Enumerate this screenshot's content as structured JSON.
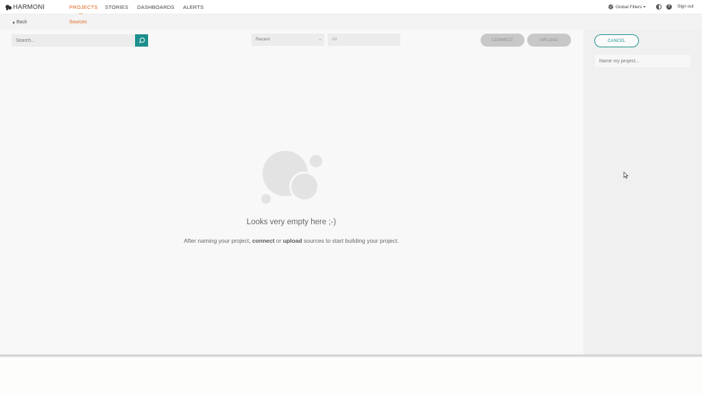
{
  "app": {
    "name": "HARMONI"
  },
  "nav": {
    "items": [
      {
        "label": "PROJECTS",
        "active": true
      },
      {
        "label": "STORIES",
        "active": false
      },
      {
        "label": "DASHBOARDS",
        "active": false
      },
      {
        "label": "ALERTS",
        "active": false
      }
    ],
    "global_filters_label": "Global Filters",
    "sign_out_label": "Sign out"
  },
  "breadcrumb": {
    "back_label": "Back",
    "current": "Sources"
  },
  "toolbar": {
    "search_placeholder": "Search...",
    "sort_select_value": "Recent",
    "filter_select_value": "All",
    "connect_label": "CONNECT",
    "upload_label": "UPLOAD"
  },
  "empty_state": {
    "title": "Looks very empty here ;-)",
    "desc_before": "After naming your project,",
    "desc_connect": "connect",
    "desc_or": "or",
    "desc_upload": "upload",
    "desc_after": "sources to start building your project."
  },
  "panel": {
    "cancel_label": "CANCEL",
    "name_placeholder": "Name my project..."
  },
  "colors": {
    "accent": "#e0641e",
    "teal": "#1c8f8c",
    "disabled": "#c8c8c8"
  }
}
